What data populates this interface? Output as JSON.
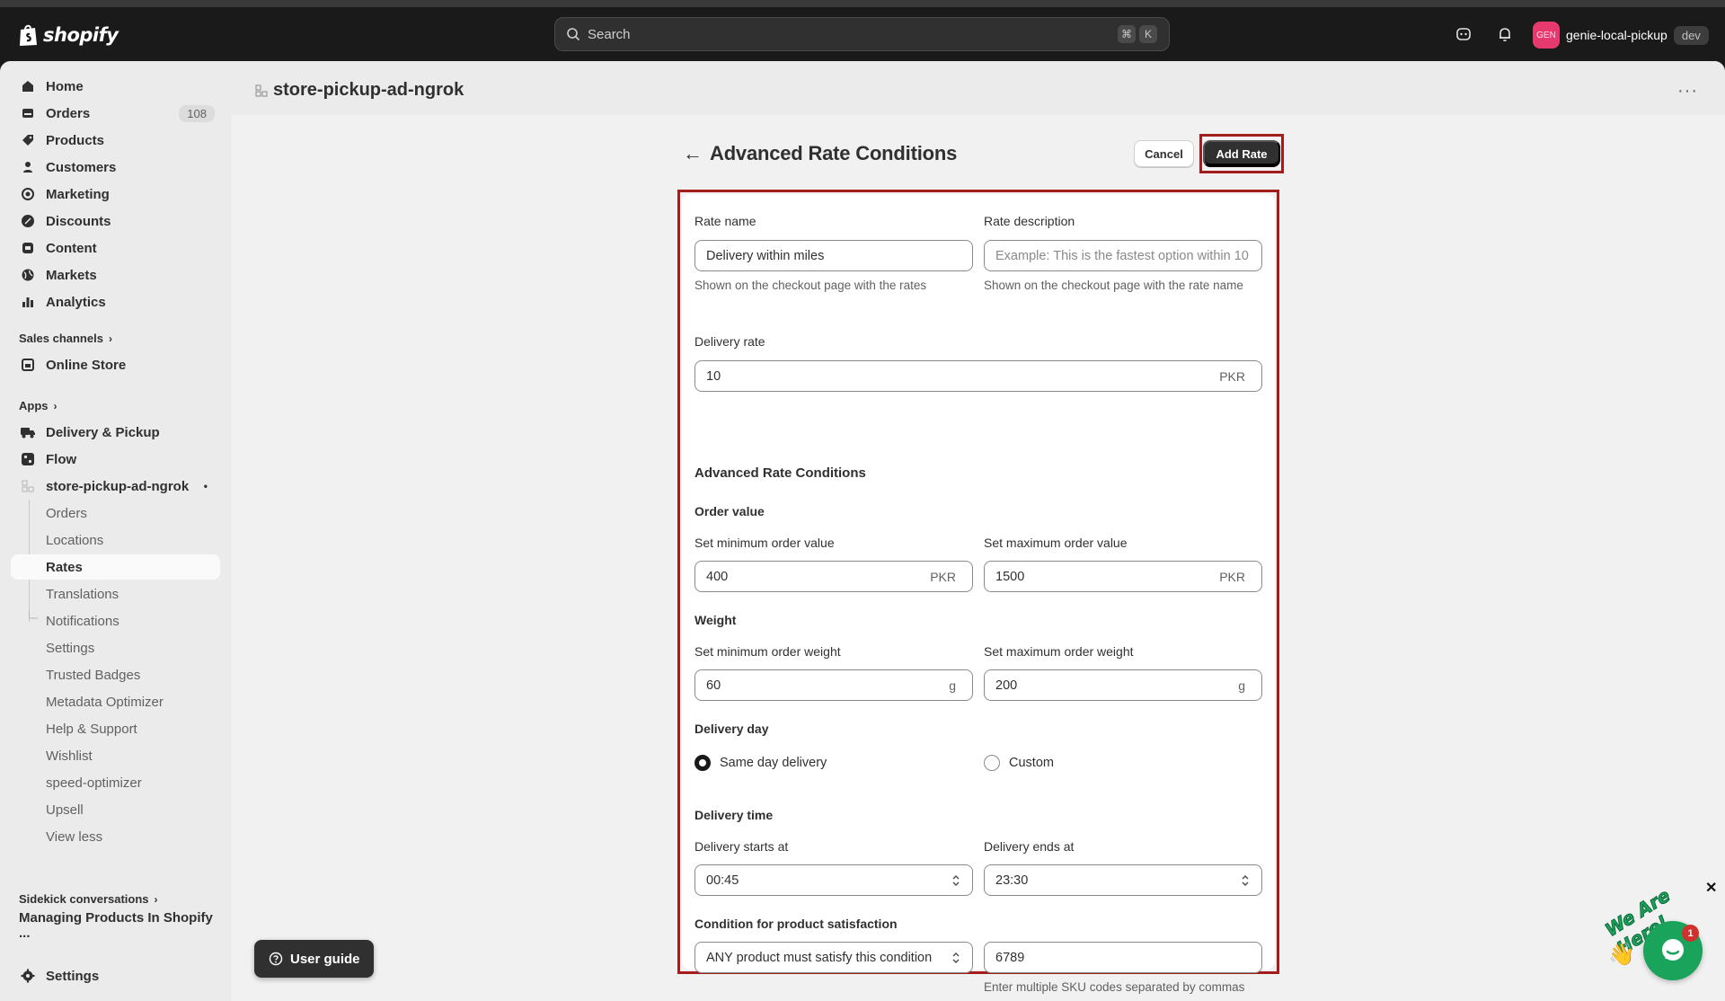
{
  "topbar": {
    "logo_text": "shopify",
    "search_placeholder": "Search",
    "shortcut_keys": [
      "⌘",
      "K"
    ],
    "avatar_initials": "GEN",
    "account_name": "genie-local-pickup",
    "env_badge": "dev"
  },
  "sidebar": {
    "main_items": [
      {
        "label": "Home",
        "icon": "home-icon"
      },
      {
        "label": "Orders",
        "icon": "orders-icon",
        "count": "108"
      },
      {
        "label": "Products",
        "icon": "tag-icon"
      },
      {
        "label": "Customers",
        "icon": "person-icon"
      },
      {
        "label": "Marketing",
        "icon": "target-icon"
      },
      {
        "label": "Discounts",
        "icon": "discount-icon"
      },
      {
        "label": "Content",
        "icon": "content-icon"
      },
      {
        "label": "Markets",
        "icon": "globe-icon"
      },
      {
        "label": "Analytics",
        "icon": "bar-chart-icon"
      }
    ],
    "sales_channels_label": "Sales channels",
    "online_store_label": "Online Store",
    "apps_label": "Apps",
    "apps": [
      {
        "label": "Delivery & Pickup"
      },
      {
        "label": "Flow"
      },
      {
        "label": "store-pickup-ad-ngrok"
      }
    ],
    "sub_items": [
      "Orders",
      "Locations",
      "Rates",
      "Translations",
      "Notifications",
      "Settings",
      "Trusted Badges",
      "Metadata Optimizer",
      "Help & Support",
      "Wishlist",
      "speed-optimizer",
      "Upsell",
      "View less"
    ],
    "sidekick_label": "Sidekick conversations",
    "sidekick_item": "Managing Products In Shopify ...",
    "settings_label": "Settings"
  },
  "page": {
    "app_title": "store-pickup-ad-ngrok",
    "heading": "Advanced Rate Conditions",
    "cancel_label": "Cancel",
    "add_rate_label": "Add Rate"
  },
  "form": {
    "rate_name_label": "Rate name",
    "rate_name_value": "Delivery within miles",
    "rate_name_help": "Shown on the checkout page with the rates",
    "rate_desc_label": "Rate description",
    "rate_desc_placeholder": "Example: This is the fastest option within 10",
    "rate_desc_help": "Shown on the checkout page with the rate name",
    "delivery_rate_label": "Delivery rate",
    "delivery_rate_value": "10",
    "currency": "PKR",
    "advanced_heading": "Advanced Rate Conditions",
    "order_value_heading": "Order value",
    "min_order_label": "Set minimum order value",
    "min_order_value": "400",
    "max_order_label": "Set maximum order value",
    "max_order_value": "1500",
    "weight_heading": "Weight",
    "min_weight_label": "Set minimum order weight",
    "min_weight_value": "60",
    "max_weight_label": "Set maximum order weight",
    "max_weight_value": "200",
    "weight_unit": "g",
    "delivery_day_heading": "Delivery day",
    "same_day_label": "Same day delivery",
    "custom_label": "Custom",
    "delivery_time_heading": "Delivery time",
    "starts_label": "Delivery starts at",
    "starts_value": "00:45",
    "ends_label": "Delivery ends at",
    "ends_value": "23:30",
    "condition_heading": "Condition for product satisfaction",
    "condition_value": "ANY product must satisfy this condition",
    "sku_value": "6789",
    "sku_help": "Enter multiple SKU codes separated by commas"
  },
  "footer": {
    "user_guide_label": "User guide",
    "chat_badge_count": "1",
    "chat_banner_text": "We Are Here!",
    "close_glyph": "✕"
  },
  "colors": {
    "highlight_border": "#a31d1d",
    "primary_button": "#303030",
    "chat_green": "#19a35b"
  }
}
